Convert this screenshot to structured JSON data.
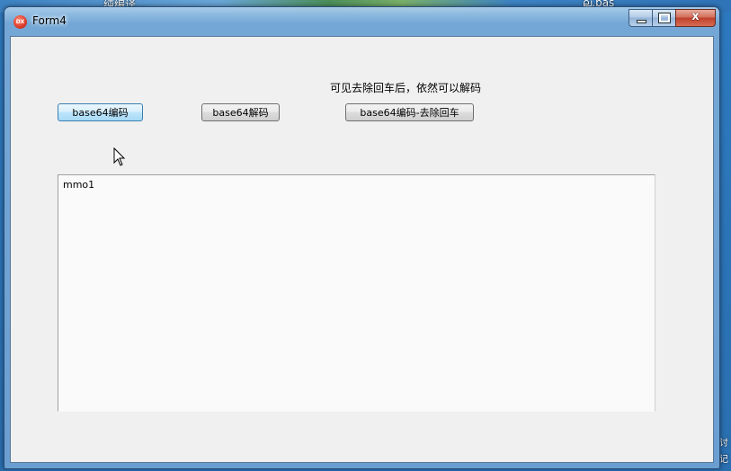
{
  "desktop": {
    "top_text_left": "纯编译...",
    "top_text_right": "ല.pas",
    "right_edge_text_1": "讨",
    "right_edge_text_2": "记"
  },
  "window": {
    "title": "Form4",
    "icon_label": "DX",
    "close_glyph": "x"
  },
  "form": {
    "hint_label": "可见去除回车后，依然可以解码",
    "buttons": {
      "encode": "base64编码",
      "decode": "base64解码",
      "encode_strip": "base64编码-去除回车"
    },
    "memo_text": "mmo1"
  },
  "colors": {
    "window_frame": "#78aad7",
    "client_bg": "#f0f0f0",
    "close_button": "#c0402a",
    "hot_button": "#bee6fd"
  }
}
